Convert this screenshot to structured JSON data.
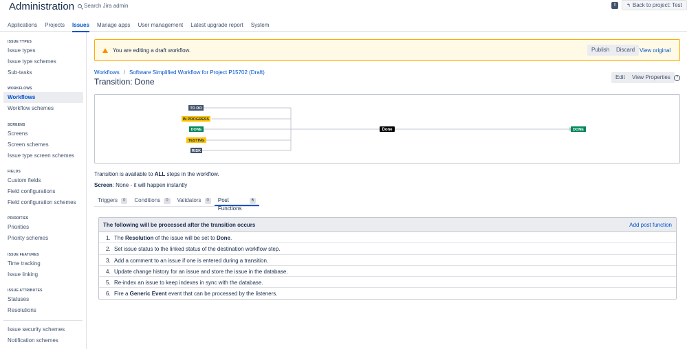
{
  "header": {
    "app_title": "Administration",
    "search_placeholder": "Search Jira admin",
    "back_label": "Back to project: Test"
  },
  "nav": {
    "tabs": [
      "Applications",
      "Projects",
      "Issues",
      "Manage apps",
      "User management",
      "Latest upgrade report",
      "System"
    ],
    "active": "Issues"
  },
  "sidebar": {
    "groups": [
      {
        "head": "ISSUE TYPES",
        "items": [
          "Issue types",
          "Issue type schemes",
          "Sub-tasks"
        ]
      },
      {
        "head": "WORKFLOWS",
        "items": [
          "Workflows",
          "Workflow schemes"
        ]
      },
      {
        "head": "SCREENS",
        "items": [
          "Screens",
          "Screen schemes",
          "Issue type screen schemes"
        ]
      },
      {
        "head": "FIELDS",
        "items": [
          "Custom fields",
          "Field configurations",
          "Field configuration schemes"
        ]
      },
      {
        "head": "PRIORITIES",
        "items": [
          "Priorities",
          "Priority schemes"
        ]
      },
      {
        "head": "ISSUE FEATURES",
        "items": [
          "Time tracking",
          "Issue linking"
        ]
      },
      {
        "head": "ISSUE ATTRIBUTES",
        "items": [
          "Statuses",
          "Resolutions"
        ]
      },
      {
        "head": "",
        "items": [
          "Issue security schemes",
          "Notification schemes"
        ]
      }
    ]
  },
  "banner": {
    "text": "You are editing a draft workflow.",
    "publish": "Publish",
    "discard": "Discard",
    "view_original": "View original"
  },
  "breadcrumb": {
    "root": "Workflows",
    "sep": "/",
    "current": "Software Simplified Workflow for Project P15702 (Draft)"
  },
  "title": "Transition: Done",
  "actions": {
    "edit": "Edit",
    "view_properties": "View Properties"
  },
  "diagram": {
    "statuses": [
      {
        "label": "TO DO",
        "color": "#42526e"
      },
      {
        "label": "IN PROGRESS",
        "color": "#ffc400"
      },
      {
        "label": "DONE",
        "color": "#00875a"
      },
      {
        "label": "TESTING",
        "color": "#ffc400"
      },
      {
        "label": "RISK",
        "color": "#42526e"
      }
    ],
    "transition": "Done",
    "target": "DONE"
  },
  "transition_info": {
    "line1_pre": "Transition is available to ",
    "line1_bold": "ALL",
    "line1_post": " steps in the workflow.",
    "line2_bold": "Screen",
    "line2_post": ": None - it will happen instantly"
  },
  "tabs": [
    {
      "label": "Triggers",
      "count": "0"
    },
    {
      "label": "Conditions",
      "count": "0"
    },
    {
      "label": "Validators",
      "count": "0"
    },
    {
      "label": "Post Functions",
      "count": "6"
    }
  ],
  "post_functions": {
    "heading": "The following will be processed after the transition occurs",
    "add_label": "Add post function",
    "items": [
      {
        "num": "1.",
        "parts": [
          "The ",
          "Resolution",
          " of the issue will be set to ",
          "Done",
          "."
        ]
      },
      {
        "num": "2.",
        "parts": [
          "Set issue status to the linked status of the destination workflow step."
        ]
      },
      {
        "num": "3.",
        "parts": [
          "Add a comment to an issue if one is entered during a transition."
        ]
      },
      {
        "num": "4.",
        "parts": [
          "Update change history for an issue and store the issue in the database."
        ]
      },
      {
        "num": "5.",
        "parts": [
          "Re-index an issue to keep indexes in sync with the database."
        ]
      },
      {
        "num": "6.",
        "parts": [
          "Fire a ",
          "Generic Event",
          " event that can be processed by the listeners."
        ]
      }
    ]
  }
}
